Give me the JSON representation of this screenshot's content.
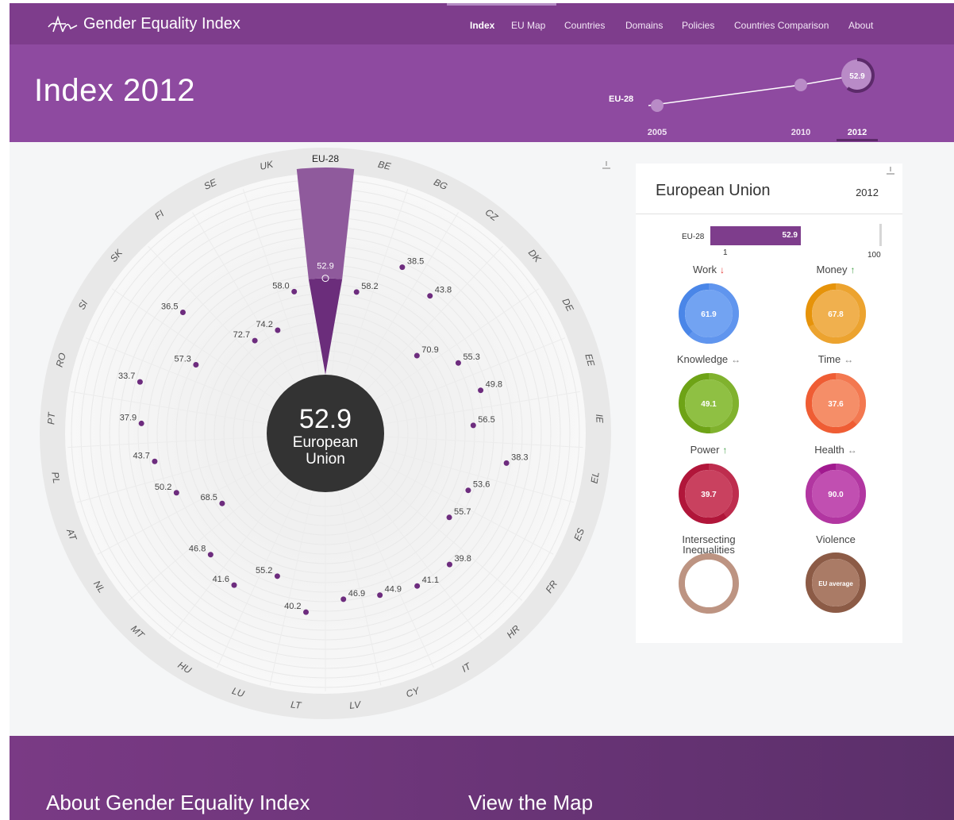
{
  "app": {
    "title": "Gender Equality Index"
  },
  "nav": {
    "items": [
      {
        "label": "Index",
        "active": true
      },
      {
        "label": "EU Map"
      },
      {
        "label": "Countries"
      },
      {
        "label": "Domains"
      },
      {
        "label": "Policies"
      },
      {
        "label": "Countries Comparison"
      },
      {
        "label": "About"
      }
    ]
  },
  "header": {
    "title": "Index 2012"
  },
  "timeline": {
    "entity": "EU-28",
    "years": [
      "2005",
      "2010",
      "2012"
    ],
    "selected_year": "2012",
    "selected_value": "52.9"
  },
  "radial": {
    "center": {
      "value": "52.9",
      "label_line1": "European",
      "label_line2": "Union"
    },
    "countries": [
      {
        "code": "EU-28",
        "value": 52.9,
        "highlight": true
      },
      {
        "code": "BE",
        "value": 58.2
      },
      {
        "code": "BG",
        "value": 38.5
      },
      {
        "code": "CZ",
        "value": 43.8
      },
      {
        "code": "DK",
        "value": 70.9
      },
      {
        "code": "DE",
        "value": 55.3
      },
      {
        "code": "EE",
        "value": 49.8
      },
      {
        "code": "IE",
        "value": 56.5
      },
      {
        "code": "EL",
        "value": 38.3
      },
      {
        "code": "ES",
        "value": 53.6
      },
      {
        "code": "FR",
        "value": 55.7
      },
      {
        "code": "HR",
        "value": 39.8
      },
      {
        "code": "IT",
        "value": 41.1
      },
      {
        "code": "CY",
        "value": 44.9
      },
      {
        "code": "LV",
        "value": 46.9
      },
      {
        "code": "LT",
        "value": 40.2
      },
      {
        "code": "LU",
        "value": 55.2
      },
      {
        "code": "HU",
        "value": 41.6
      },
      {
        "code": "MT",
        "value": 46.8
      },
      {
        "code": "NL",
        "value": 68.5
      },
      {
        "code": "AT",
        "value": 50.2
      },
      {
        "code": "PL",
        "value": 43.7
      },
      {
        "code": "PT",
        "value": 37.9
      },
      {
        "code": "RO",
        "value": 33.7
      },
      {
        "code": "SI",
        "value": 57.3
      },
      {
        "code": "SK",
        "value": 36.5
      },
      {
        "code": "FI",
        "value": 72.7
      },
      {
        "code": "SE",
        "value": 74.2
      },
      {
        "code": "UK",
        "value": 58.0
      }
    ]
  },
  "panel": {
    "title": "European Union",
    "year": "2012",
    "bar": {
      "label": "EU-28",
      "value": 52.9,
      "value_text": "52.9",
      "min": "1",
      "max": "100"
    },
    "domains": [
      {
        "name": "Work",
        "trend": "↓",
        "trend_color": "#e53935",
        "value": "61.9",
        "color": "#4a86e8",
        "light": "#72a3f2",
        "level": 0.619
      },
      {
        "name": "Money",
        "trend": "↑",
        "trend_color": "#43a047",
        "value": "67.8",
        "color": "#e6930a",
        "light": "#f0b04e",
        "level": 0.678
      },
      {
        "name": "Knowledge",
        "trend": "↔",
        "trend_color": "#888888",
        "value": "49.1",
        "color": "#6ea316",
        "light": "#8fc043",
        "level": 0.491
      },
      {
        "name": "Time",
        "trend": "↔",
        "trend_color": "#888888",
        "value": "37.6",
        "color": "#ef5d34",
        "light": "#f58e68",
        "level": 0.376
      },
      {
        "name": "Power",
        "trend": "↑",
        "trend_color": "#43a047",
        "value": "39.7",
        "color": "#b1163a",
        "light": "#c9415f",
        "level": 0.397
      },
      {
        "name": "Health",
        "trend": "↔",
        "trend_color": "#888888",
        "value": "90.0",
        "color": "#a1198f",
        "light": "#c14fb1",
        "level": 0.9
      },
      {
        "name": "Intersecting\nInequalities",
        "trend": "",
        "trend_color": "#888888",
        "value": "",
        "color": "#bd9482",
        "light": "#ffffff",
        "level": 1
      },
      {
        "name": "Violence",
        "trend": "",
        "trend_color": "#888888",
        "value": "EU average",
        "color": "#8c5b46",
        "light": "#aa7b66",
        "level": 1
      }
    ]
  },
  "footer": {
    "link1": "About Gender Equality Index",
    "link2": "View the Map"
  },
  "colors": {
    "topbar": "#7e3d8c",
    "header": "#8e4aa0",
    "accent": "#6b2d7b",
    "dot": "#6d2c7e"
  }
}
